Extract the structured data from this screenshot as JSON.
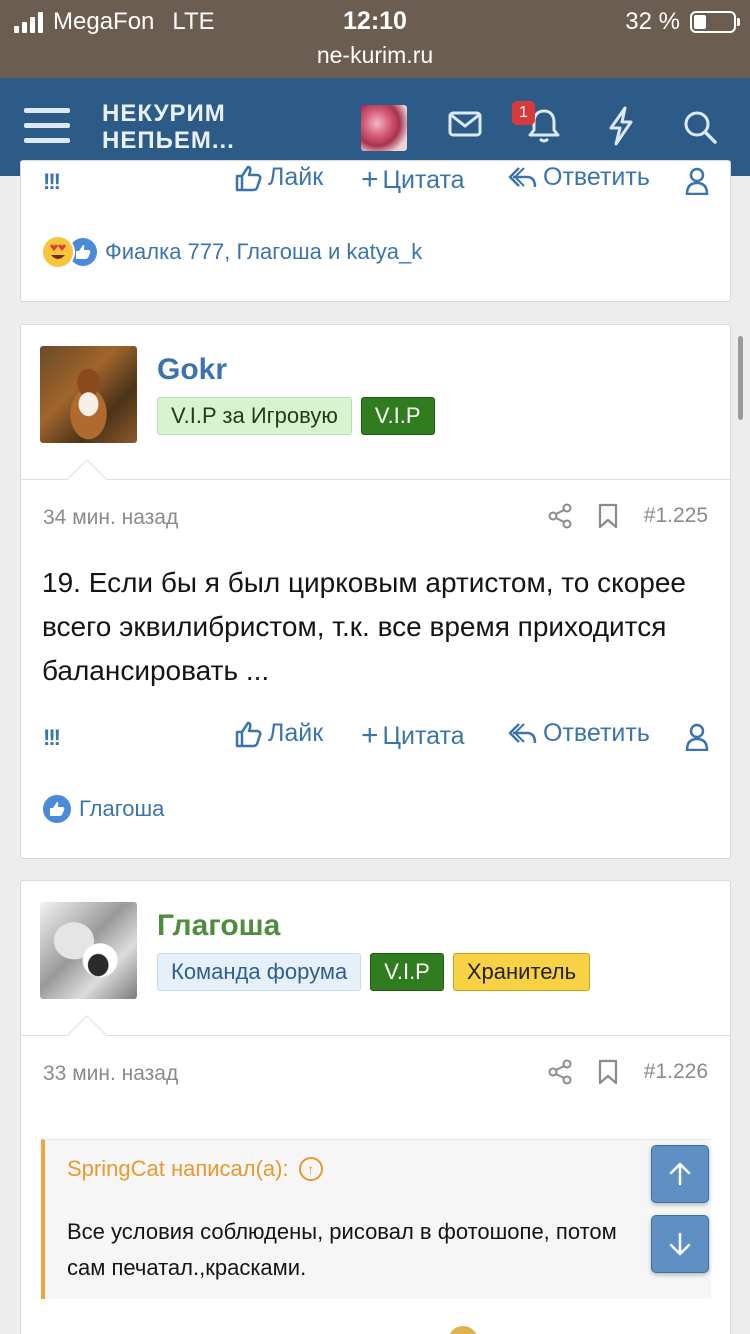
{
  "status_bar": {
    "carrier": "MegaFon",
    "network": "LTE",
    "time": "12:10",
    "url": "ne-kurim.ru",
    "battery": "32 %",
    "battery_level": 0.32
  },
  "navbar": {
    "logo_line1": "НЕКУРИМ",
    "logo_line2": "НЕПЬЕМ...",
    "notifications_count": "1",
    "icons": [
      "menu-icon",
      "avatar",
      "mail-icon",
      "bell-icon",
      "lightning-icon",
      "search-icon"
    ],
    "color": "#2c5b88"
  },
  "post_prev": {
    "exclamations": "!!!",
    "actions": {
      "like": "Лайк",
      "quote": "Цитата",
      "reply": "Ответить"
    },
    "reactions_text": "Фиалка 777, Глагоша и katya_k"
  },
  "post1": {
    "username": "Gokr",
    "username_color": "#3b74ad",
    "tags": [
      "V.I.P за Игровую",
      "V.I.P"
    ],
    "time": "34 мин. назад",
    "number": "#1.225",
    "text": "19. Если бы я был цирковым артистом, то скорее всего эквилибристом, т.к. все время приходится балансировать ...",
    "exclamations": "!!!",
    "actions": {
      "like": "Лайк",
      "quote": "Цитата",
      "reply": "Ответить"
    },
    "reactions_text": "Глагоша"
  },
  "post2": {
    "username": "Глагоша",
    "username_color": "#4f8c3f",
    "tags": [
      "Команда форума",
      "V.I.P",
      "Хранитель"
    ],
    "time": "33 мин. назад",
    "number": "#1.226",
    "quote_author": "SpringCat написал(а):",
    "quote_text": "Все условия соблюдены, рисовал в фотошопе, потом сам печатал.,красками."
  }
}
